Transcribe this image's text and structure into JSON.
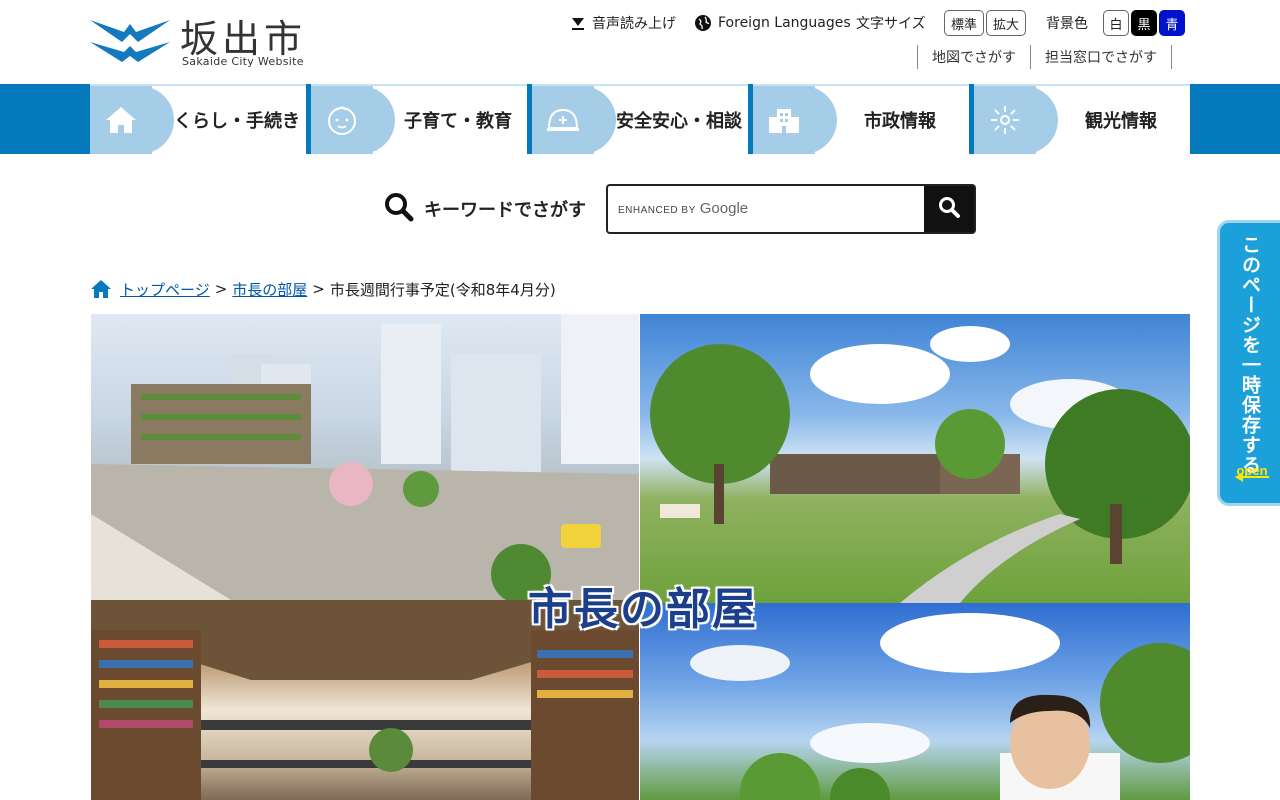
{
  "site": {
    "title": "坂出市",
    "subtitle": "Sakaide City Website"
  },
  "utility": {
    "voice": "音声読み上げ",
    "foreign": "Foreign Languages",
    "text_size_label": "文字サイズ",
    "text_size_standard": "標準",
    "text_size_large": "拡大",
    "bg_color_label": "背景色",
    "bg_white": "白",
    "bg_black": "黒",
    "bg_blue": "青",
    "map_search": "地図でさがす",
    "office_search": "担当窓口でさがす"
  },
  "nav": {
    "items": [
      {
        "label": "くらし・手続き",
        "icon": "house-icon"
      },
      {
        "label": "子育て・教育",
        "icon": "baby-icon"
      },
      {
        "label": "安全安心・相談",
        "icon": "helmet-icon"
      },
      {
        "label": "市政情報",
        "icon": "building-icon"
      },
      {
        "label": "観光情報",
        "icon": "firework-icon"
      }
    ]
  },
  "search": {
    "label": "キーワードでさがす",
    "placeholder_prefix": "ENHANCED BY",
    "placeholder_brand": "Google"
  },
  "breadcrumb": {
    "home": "トップページ",
    "parent": "市長の部屋",
    "current": "市長週間行事予定(令和8年4月分)",
    "separator": ">"
  },
  "hero": {
    "title": "市長の部屋"
  },
  "side_tab": {
    "text": "このページを一時保存する",
    "open": "open"
  },
  "colors": {
    "nav_blue": "#0479bb",
    "nav_icon_bg": "#a6cde8",
    "side_tab": "#1ca0da",
    "link": "#0055aa"
  }
}
